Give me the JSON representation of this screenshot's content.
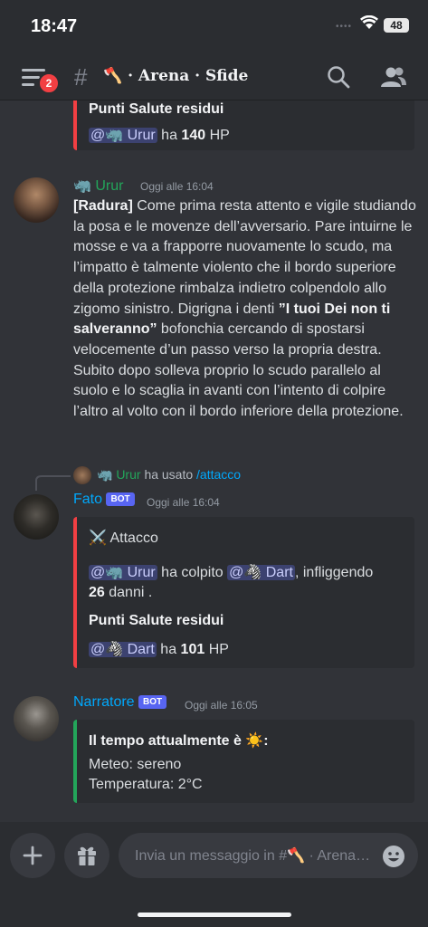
{
  "status": {
    "time": "18:47",
    "battery": "48"
  },
  "header": {
    "badge": "2",
    "channel": "🪓 · Arena · Sfide"
  },
  "m1": {
    "embed_title": "Punti Salute residui",
    "mention": "@🦏 Urur",
    "has": "ha",
    "hp_value": "140",
    "hp_unit": "HP"
  },
  "m2": {
    "author": "🦏 Urur",
    "timestamp": "Oggi alle 16:04",
    "tag": "[Radura]",
    "text1": " Come prima resta attento e vigile studiando la posa e le movenze dell’avversario. Pare intuirne le mosse e va a frapporre nuovamente lo scudo, ma l’impatto è talmente violento che il bordo superiore della protezione rimbalza indietro colpendolo allo zigomo sinistro. Digrigna i denti ",
    "quote": "”I tuoi Dei non ti salveranno”",
    "text2": " bofonchia cercando di spostarsi velocemente d’un passo verso la propria destra. Subito dopo solleva proprio lo scudo parallelo al suolo e lo scaglia in avanti con l’intento di colpire l’altro al volto con il bordo inferiore della protezione."
  },
  "m3": {
    "reply_user": "🦏 Urur",
    "reply_used": "ha usato",
    "reply_command": "/attacco",
    "author": "Fato",
    "bot": "BOT",
    "timestamp": "Oggi alle 16:04",
    "embed_title": "⚔️ Attacco",
    "attacker": "@🦏 Urur",
    "hit_text": "ha colpito",
    "target": "@🦓 Dart",
    "inflict": ", infliggendo",
    "damage": "26",
    "damage_unit": "danni",
    "hp_title": "Punti Salute residui",
    "hp_mention": "@🦓 Dart",
    "has": "ha",
    "hp_value": "101",
    "hp_unit": "HP"
  },
  "m4": {
    "author": "Narratore",
    "bot": "BOT",
    "timestamp": "Oggi alle 16:05",
    "embed_title": "Il tempo attualmente è ☀️:",
    "weather": "Meteo: sereno",
    "temperature": "Temperatura: 2°C"
  },
  "composer": {
    "placeholder": "Invia un messaggio in #🪓 · Arena · Sfide"
  },
  "colors": {
    "accent_red": "#f23f43",
    "accent_green": "#23a55a",
    "bot_badge": "#5865f2",
    "mention_bg": "#3c4270",
    "link": "#00a8fc"
  }
}
